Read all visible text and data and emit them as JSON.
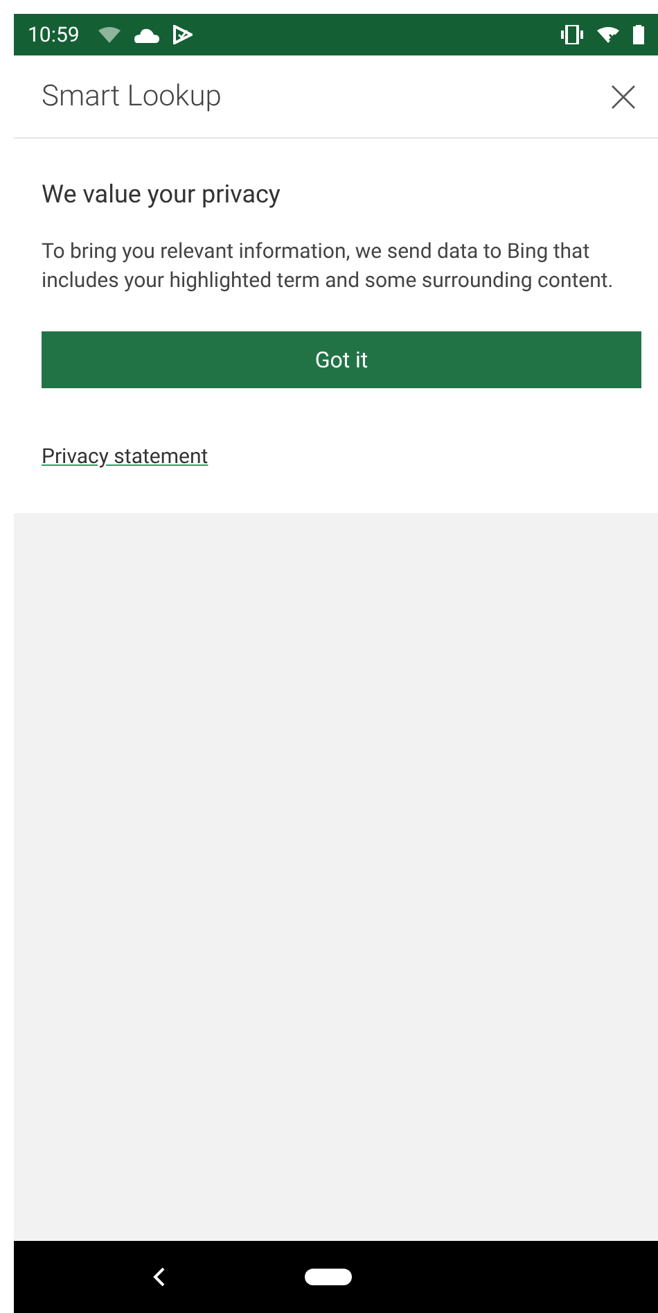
{
  "status_bar": {
    "time": "10:59"
  },
  "header": {
    "title": "Smart Lookup"
  },
  "privacy": {
    "heading": "We value your privacy",
    "body": "To bring you relevant information, we send data to Bing that includes your highlighted term and some surrounding content.",
    "button": "Got it",
    "link": "Privacy statement"
  }
}
